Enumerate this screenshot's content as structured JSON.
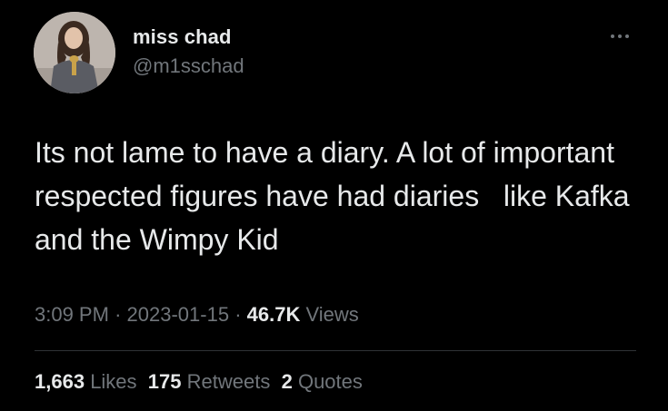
{
  "author": {
    "display_name": "miss chad",
    "handle": "@m1sschad",
    "avatar_icon": "profile-photo-avatar"
  },
  "menu": {
    "icon": "more-options-icon"
  },
  "tweet": {
    "text": "Its not lame to have a diary. A lot of important respected figures have had diaries   like Kafka and the Wimpy Kid"
  },
  "meta": {
    "time": "3:09 PM",
    "separator": "·",
    "date": "2023-01-15",
    "views_count": "46.7K",
    "views_label": "Views"
  },
  "stats": {
    "likes_count": "1,663",
    "likes_label": "Likes",
    "retweets_count": "175",
    "retweets_label": "Retweets",
    "quotes_count": "2",
    "quotes_label": "Quotes"
  },
  "colors": {
    "background": "#000000",
    "primary_text": "#e7e9ea",
    "secondary_text": "#71767b",
    "divider": "#2f3336"
  }
}
